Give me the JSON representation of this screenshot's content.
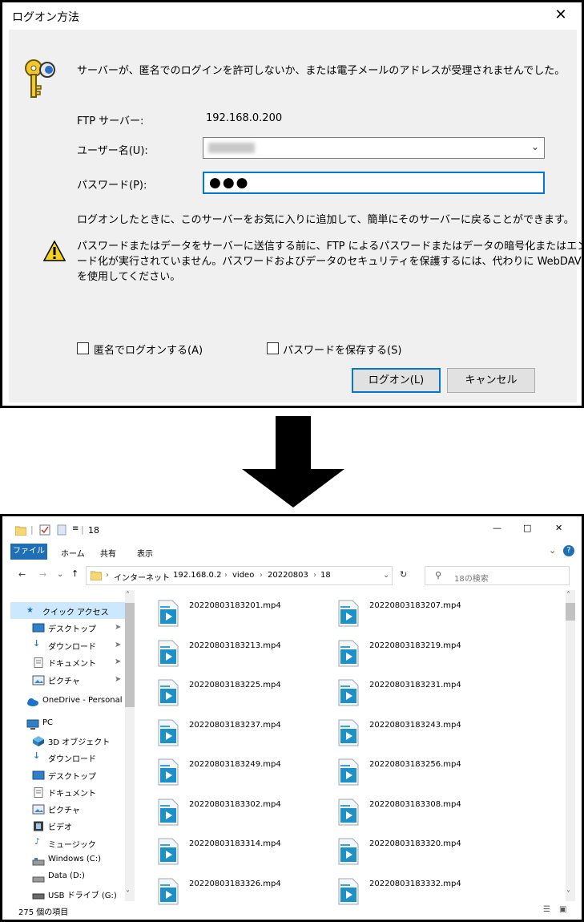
{
  "dialog": {
    "title": "ログオン方法",
    "close_glyph": "✕",
    "message": "サーバーが、匿名でのログインを許可しないか、または電子メールのアドレスが受理されませんでした。",
    "ftp_server_label": "FTP サーバー:",
    "ftp_server_value": "192.168.0.200",
    "username_label": "ユーザー名(U):",
    "password_label": "パスワード(P):",
    "password_mask": "●●●",
    "info_text": "ログオンしたときに、このサーバーをお気に入りに追加して、簡単にそのサーバーに戻ることができます。",
    "warning_lines": [
      "パスワードまたはデータをサーバーに送信する前に、FTP によるパスワードまたはデータの暗号化またはエンコ",
      "ード化が実行されていません。パスワードおよびデータのセキュリティを保護するには、代わりに WebDAV",
      "を使用してください。"
    ],
    "anonymous_checkbox": "匿名でログオンする(A)",
    "save_password_checkbox": "パスワードを保存する(S)",
    "logon_button": "ログオン(L)",
    "cancel_button": "キャンセル"
  },
  "explorer": {
    "window_title": "18",
    "ribbon_tabs": [
      "ファイル",
      "ホーム",
      "共有",
      "表示"
    ],
    "breadcrumb": [
      "インターネット",
      "192.168.0.2",
      "video",
      "20220803",
      "18"
    ],
    "search_placeholder": "18の検索",
    "nav": {
      "quick_access": "クイック アクセス",
      "quick_items": [
        "デスクトップ",
        "ダウンロード",
        "ドキュメント",
        "ピクチャ"
      ],
      "onedrive": "OneDrive - Personal",
      "pc": "PC",
      "pc_items": [
        "3D オブジェクト",
        "ダウンロード",
        "デスクトップ",
        "ドキュメント",
        "ピクチャ",
        "ビデオ",
        "ミュージック",
        "Windows (C:)",
        "Data (D:)",
        "USB ドライブ (G:)"
      ]
    },
    "files": [
      "20220803183201.mp4",
      "20220803183207.mp4",
      "20220803183213.mp4",
      "20220803183219.mp4",
      "20220803183225.mp4",
      "20220803183231.mp4",
      "20220803183237.mp4",
      "20220803183243.mp4",
      "20220803183249.mp4",
      "20220803183256.mp4",
      "20220803183302.mp4",
      "20220803183308.mp4",
      "20220803183314.mp4",
      "20220803183320.mp4",
      "20220803183326.mp4",
      "20220803183332.mp4"
    ],
    "status": "275 個の項目",
    "colors": {
      "accent": "#0078d7",
      "ribbon_file": "#1f6fb7",
      "video_icon": "#1e90c8"
    }
  }
}
